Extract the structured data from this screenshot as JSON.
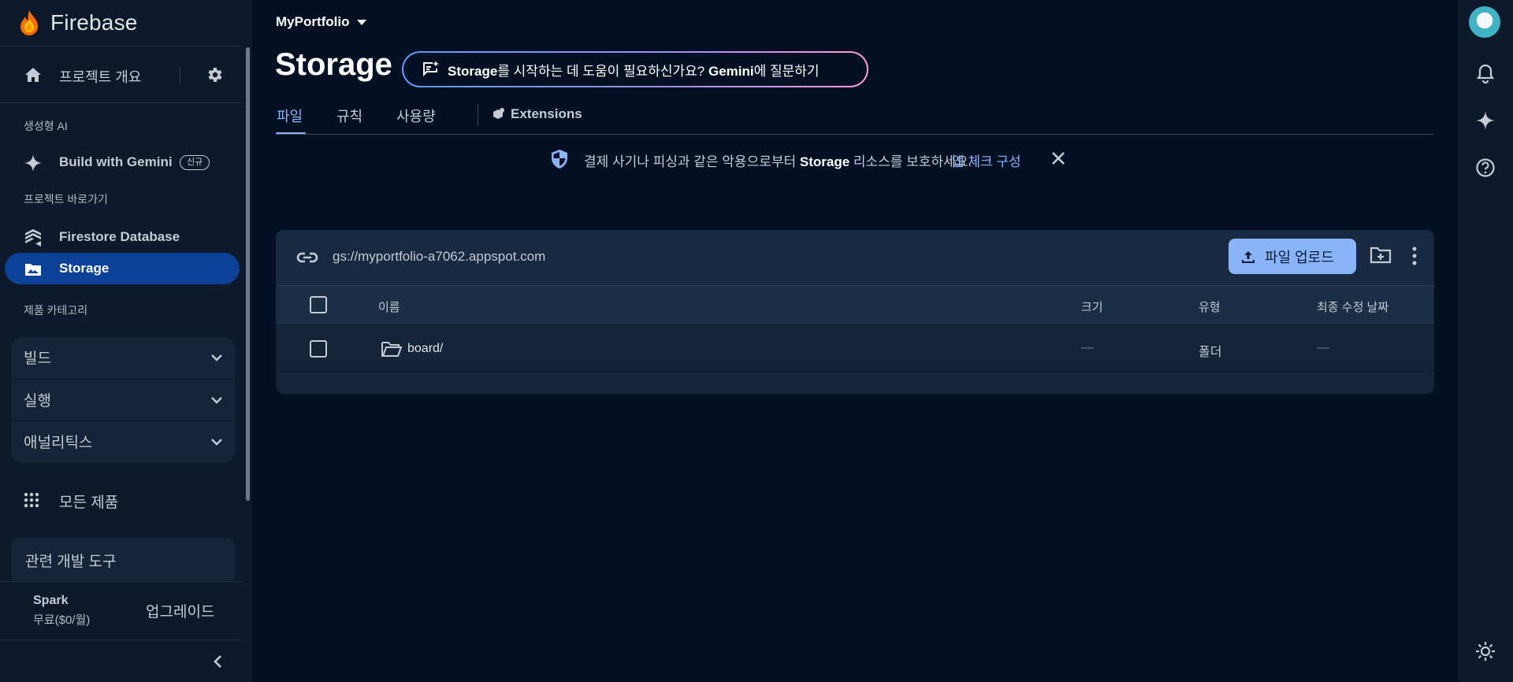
{
  "sidebar": {
    "brand": "Firebase",
    "overview_label": "프로젝트 개요",
    "section_genai": "생성형 AI",
    "build_with_gemini": "Build with Gemini",
    "new_badge": "신규",
    "section_shortcuts": "프로젝트 바로가기",
    "firestore": "Firestore Database",
    "storage": "Storage",
    "section_categories": "제품 카테고리",
    "categories": [
      "빌드",
      "실행",
      "애널리틱스"
    ],
    "all_products": "모든 제품",
    "dev_tools": "관련 개발 도구",
    "plan_name": "Spark",
    "plan_price": "무료($0/월)",
    "upgrade": "업그레이드"
  },
  "header": {
    "project_name": "MyPortfolio",
    "page_title": "Storage",
    "gemini_prompt_bold1": "Storage",
    "gemini_prompt_part1": "를 시작하는 데 도움이 필요하신가요? ",
    "gemini_prompt_bold2": "Gemini",
    "gemini_prompt_part2": "에 질문하기"
  },
  "tabs": {
    "files": "파일",
    "rules": "규칙",
    "usage": "사용량",
    "extensions": "Extensions"
  },
  "banner": {
    "message_part1": "결제 사기나 피싱과 같은 악용으로부터 ",
    "message_bold": "Storage",
    "message_part2": " 리소스를 보호하세요.",
    "link": "앱 체크 구성"
  },
  "files": {
    "bucket_url": "gs://myportfolio-a7062.appspot.com",
    "upload_label": "파일 업로드",
    "columns": {
      "name": "이름",
      "size": "크기",
      "type": "유형",
      "modified": "최종 수정 날짜"
    },
    "rows": [
      {
        "name": "board/",
        "size": "—",
        "type": "폴더",
        "modified": "—"
      }
    ]
  },
  "colors": {
    "background": "#041124",
    "sidebar": "#0c1a2c",
    "accent": "#8ab4f8",
    "active_nav": "#0b4196"
  }
}
